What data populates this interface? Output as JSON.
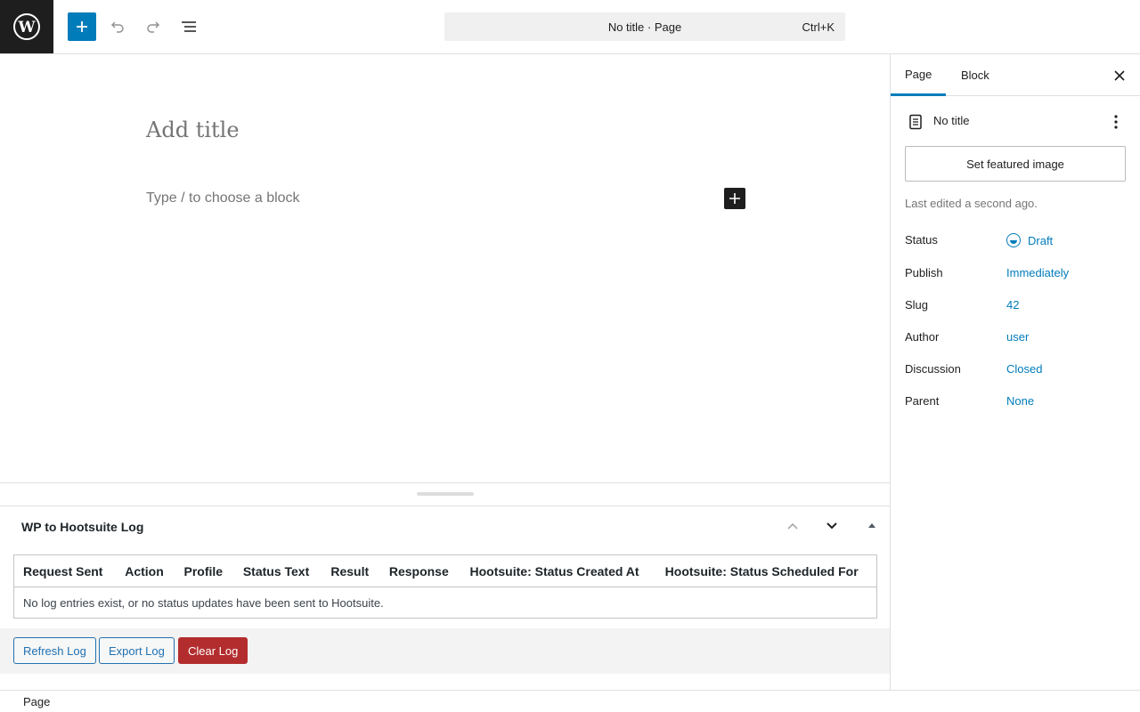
{
  "header": {
    "command_bar_text": "No title · Page",
    "command_shortcut": "Ctrl+K",
    "icons": [
      "wordpress-logo-icon",
      "plus-icon",
      "undo-icon",
      "redo-icon",
      "list-view-icon"
    ]
  },
  "editor": {
    "title_placeholder": "Add title",
    "block_placeholder": "Type / to choose a block"
  },
  "metabox": {
    "title": "WP to Hootsuite Log",
    "columns": [
      "Request Sent",
      "Action",
      "Profile",
      "Status Text",
      "Result",
      "Response",
      "Hootsuite: Status Created At",
      "Hootsuite: Status Scheduled For"
    ],
    "empty_message": "No log entries exist, or no status updates have been sent to Hootsuite.",
    "buttons": {
      "refresh": "Refresh Log",
      "export": "Export Log",
      "clear": "Clear Log"
    }
  },
  "footer": {
    "breadcrumb": "Page"
  },
  "sidebar": {
    "tabs": [
      "Page",
      "Block"
    ],
    "active_tab": "Page",
    "document_title": "No title",
    "featured_image_button": "Set featured image",
    "last_edited": "Last edited a second ago.",
    "meta": [
      {
        "label": "Status",
        "value": "Draft"
      },
      {
        "label": "Publish",
        "value": "Immediately"
      },
      {
        "label": "Slug",
        "value": "42"
      },
      {
        "label": "Author",
        "value": "user"
      },
      {
        "label": "Discussion",
        "value": "Closed"
      },
      {
        "label": "Parent",
        "value": "None"
      }
    ]
  },
  "colors": {
    "accent": "#007cba",
    "danger": "#b32d2e",
    "dark": "#1e1e1e"
  }
}
